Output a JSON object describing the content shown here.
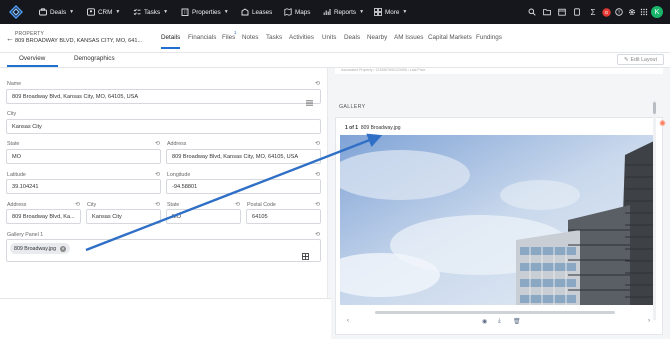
{
  "nav": {
    "items": [
      {
        "label": "Deals",
        "icon": "briefcase-icon"
      },
      {
        "label": "CRM",
        "icon": "contacts-icon"
      },
      {
        "label": "Tasks",
        "icon": "checklist-icon"
      },
      {
        "label": "Properties",
        "icon": "building-icon"
      },
      {
        "label": "Leases",
        "icon": "lease-icon"
      },
      {
        "label": "Maps",
        "icon": "map-icon"
      },
      {
        "label": "Reports",
        "icon": "chart-icon"
      },
      {
        "label": "More",
        "icon": "grid-icon"
      }
    ],
    "right_icons": [
      "search-icon",
      "folder-icon",
      "calendar-icon",
      "notification-icon",
      "sigma-icon",
      "user-badge",
      "help-icon",
      "settings-icon",
      "apps-icon"
    ],
    "avatar_initial": "K",
    "colors": {
      "bar": "#15171c",
      "avatar": "#19b56b",
      "badge": "#e53935"
    }
  },
  "header": {
    "type_label": "PROPERTY",
    "address": "809 BROADWAY BLVD, KANSAS CITY, MO, 641...",
    "tabs": [
      "Details",
      "Financials",
      "Files",
      "Notes",
      "Tasks",
      "Activities",
      "Units",
      "Deals",
      "Nearby",
      "AM Issues",
      "Capital Markets",
      "Fundings"
    ],
    "active_tab": "Details",
    "files_badge": "1"
  },
  "subtabs": {
    "overview": "Overview",
    "demographics": "Demographics",
    "edit_layout": "Edit Layout"
  },
  "form": {
    "name": {
      "label": "Name",
      "value": "809 Broadway Blvd, Kansas City, MO, 64105, USA"
    },
    "city": {
      "label": "City",
      "value": "Kansas City"
    },
    "state": {
      "label": "State",
      "value": "MO"
    },
    "address": {
      "label": "Address",
      "value": "809 Broadway Blvd, Kansas City, MO, 64105, USA"
    },
    "latitude": {
      "label": "Latitude",
      "value": "39.104241"
    },
    "longitude": {
      "label": "Longitude",
      "value": "-94.58801"
    },
    "address2": {
      "label": "Address",
      "value": "809 Broadway Blvd, Ka..."
    },
    "city2": {
      "label": "City",
      "value": "Kansas City"
    },
    "state2": {
      "label": "State",
      "value": "MO"
    },
    "postal": {
      "label": "Postal Code",
      "value": "64105"
    },
    "gallery": {
      "label": "Gallery Panel 1",
      "file": "809 Broadway.jpg"
    }
  },
  "gallery": {
    "title": "GALLERY",
    "count": "1 of 1",
    "filename": "809 Broadway.jpg",
    "controls": [
      "eye-icon",
      "download-icon",
      "trash-icon"
    ]
  },
  "rtop_text": "Associated Property  •  1234567890123456  •  Last Price"
}
